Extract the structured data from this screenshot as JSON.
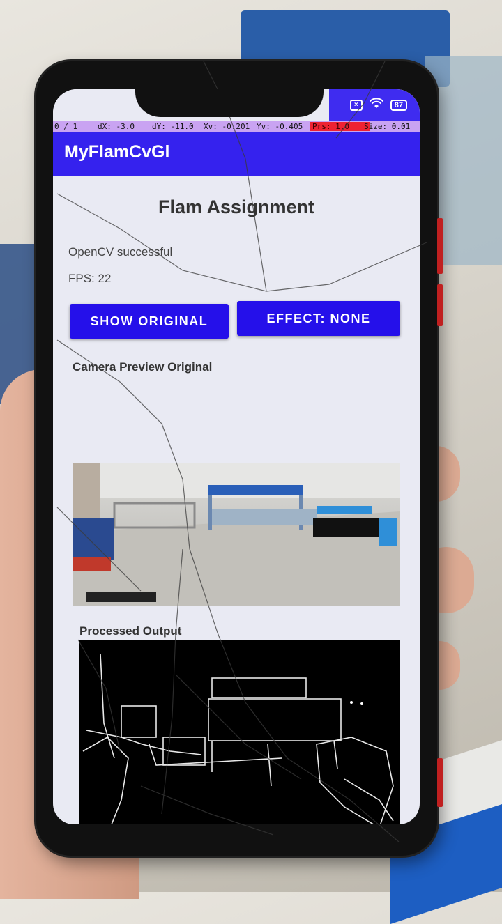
{
  "status_bar": {
    "battery": "87"
  },
  "debug_bar": {
    "frame": "0 / 1",
    "dx": "dX: -3.0",
    "dy": "dY: -11.0",
    "xv": "Xv: -0.201",
    "yv": "Yv: -0.405",
    "prs": "Prs: 1.0",
    "size": "Size: 0.01",
    "highlight_color": "#ee2233"
  },
  "app_bar": {
    "title": "MyFlamCvGl",
    "color": "#3522ee"
  },
  "main": {
    "title": "Flam Assignment",
    "opencv_status": "OpenCV successful",
    "fps": "FPS: 22",
    "show_original_button": "SHOW ORIGINAL",
    "effect_button": "EFFECT: NONE",
    "button_color": "#2510ea",
    "preview_label": "Camera Preview Original",
    "processed_label": "Processed Output"
  }
}
